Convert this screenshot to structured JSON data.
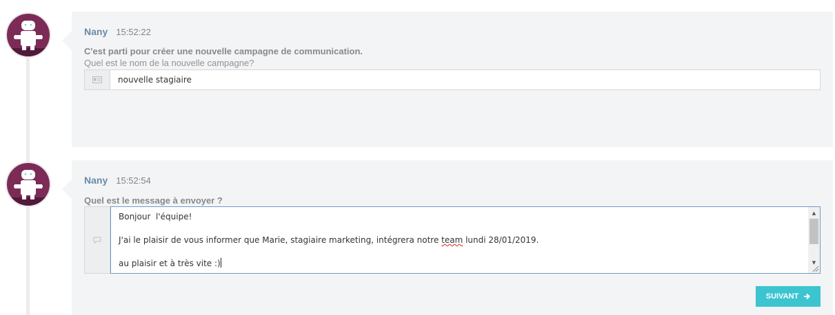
{
  "messages": [
    {
      "author": "Nany",
      "time": "15:52:22",
      "title": "C'est parti pour créer une nouvelle campagne de communication.",
      "subtitle": "Quel est le nom de la nouvelle campagne?",
      "input_value": "nouvelle stagiaire",
      "input_icon": "id-card-icon"
    },
    {
      "author": "Nany",
      "time": "15:52:54",
      "title": "Quel est le message à envoyer ?",
      "textarea_icon": "comment-icon",
      "textarea_lines": {
        "line1": "Bonjour  l'équipe!",
        "line2_before": "J'ai le plaisir de vous informer que Marie, stagiaire marketing, intégrera notre ",
        "line2_misspelled": "team",
        "line2_after": " lundi 28/01/2019.",
        "line3": "au plaisir et à très vite :)"
      },
      "next_label": "SUIVANT",
      "next_icon": "arrow-right-icon"
    }
  ],
  "colors": {
    "avatar_bg": "#7c2b57",
    "author": "#6a8aa8",
    "button": "#3cc4d0",
    "card_bg": "#f3f4f5",
    "focus_border": "#6e9cc6"
  }
}
